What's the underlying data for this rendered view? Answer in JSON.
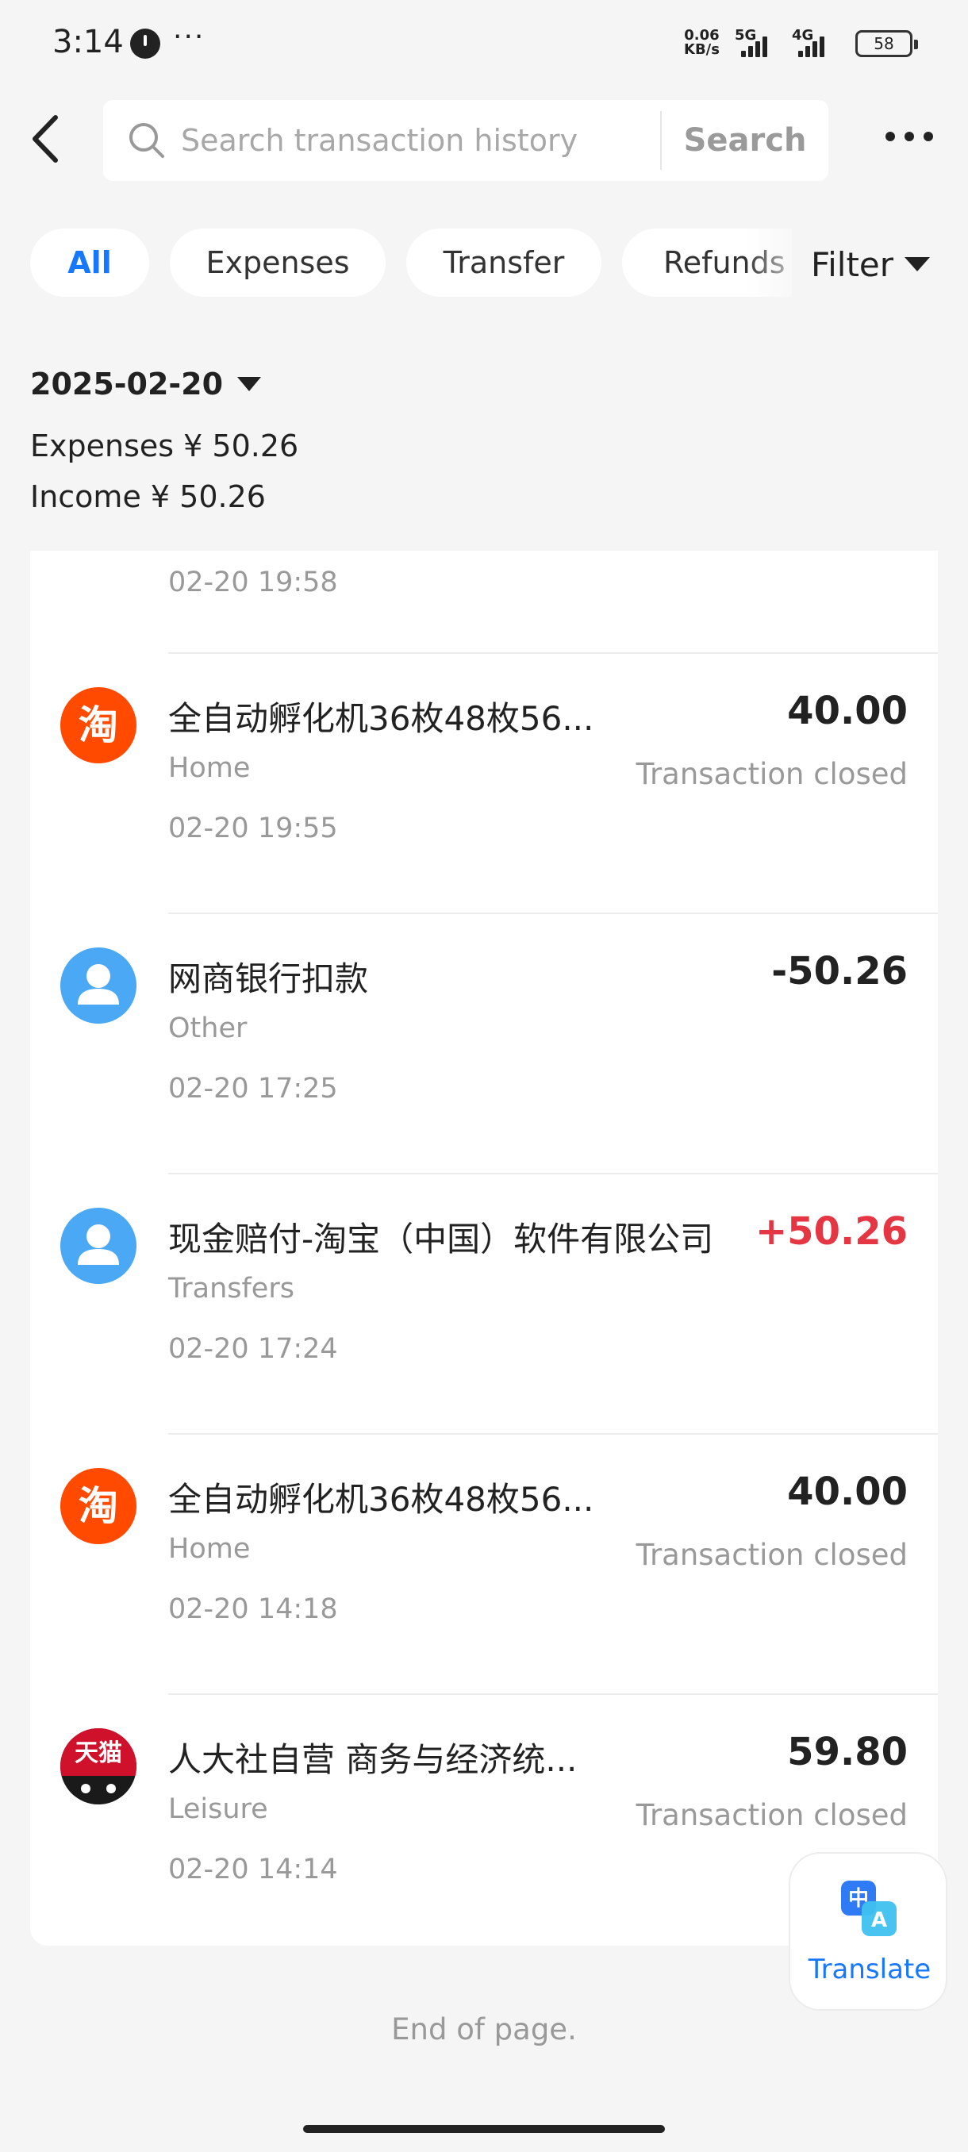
{
  "status_bar": {
    "time": "3:14",
    "more": "···",
    "speed_top": "0.06",
    "speed_bottom": "KB/s",
    "network_1": "5G",
    "network_2": "4G",
    "battery": "58"
  },
  "header": {
    "search_placeholder": "Search transaction history",
    "search_button": "Search"
  },
  "tabs": [
    {
      "label": "All",
      "active": true
    },
    {
      "label": "Expenses",
      "active": false
    },
    {
      "label": "Transfer",
      "active": false
    },
    {
      "label": "Refunds",
      "active": false
    }
  ],
  "filter_label": "Filter",
  "summary": {
    "date": "2025-02-20",
    "expenses": "Expenses ¥ 50.26",
    "income": "Income ¥ 50.26"
  },
  "transactions": [
    {
      "time": "02-20 19:58"
    },
    {
      "icon": "taobao-icon",
      "avatar_text": "淘",
      "title": "全自动孵化机36枚48枚56...",
      "category": "Home",
      "time": "02-20 19:55",
      "amount": "40.00",
      "status": "Transaction closed"
    },
    {
      "icon": "person-icon",
      "title": "网商银行扣款",
      "category": "Other",
      "time": "02-20 17:25",
      "amount": "-50.26",
      "status": ""
    },
    {
      "icon": "person-icon",
      "title": "现金赔付-淘宝（中国）软件有限公司",
      "category": "Transfers",
      "time": "02-20 17:24",
      "amount": "+50.26",
      "status": ""
    },
    {
      "icon": "taobao-icon",
      "avatar_text": "淘",
      "title": "全自动孵化机36枚48枚56...",
      "category": "Home",
      "time": "02-20 14:18",
      "amount": "40.00",
      "status": "Transaction closed"
    },
    {
      "icon": "tmall-icon",
      "avatar_text": "天猫",
      "title": "人大社自营 商务与经济统...",
      "category": "Leisure",
      "time": "02-20 14:14",
      "amount": "59.80",
      "status": "Transaction closed"
    }
  ],
  "translate_label": "Translate",
  "footer": "End of page.",
  "colors": {
    "accent": "#1677ff",
    "positive_amount": "#e53643",
    "taobao": "#ff4a00",
    "person_avatar": "#4aa8f5",
    "tmall": "#d0112b"
  }
}
